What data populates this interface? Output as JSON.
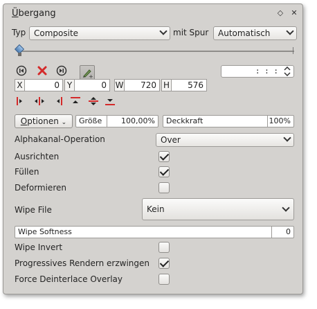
{
  "panel": {
    "title": "Übergang",
    "title_first": "Ü",
    "title_rest": "bergang",
    "float_icon": "◇",
    "close_icon": "✕"
  },
  "row_type": {
    "type_label": "Typ",
    "type_value": "Composite",
    "track_label": "mit Spur",
    "track_value": "Automatisch"
  },
  "timecode": {
    "value": ": : :"
  },
  "geometry": {
    "x_label": "X",
    "x_value": "0",
    "y_label": "Y",
    "y_value": "0",
    "w_label": "W",
    "w_value": "720",
    "h_label": "H",
    "h_value": "576"
  },
  "options": {
    "button_first": "O",
    "button_rest": "ptionen",
    "size_label": "Größe",
    "size_value": "100,00%",
    "opacity_label": "Deckkraft",
    "opacity_value": "100%"
  },
  "params": {
    "alpha_label": "Alphakanal-Operation",
    "alpha_value": "Over",
    "align_label": "Ausrichten",
    "fill_label": "Füllen",
    "distort_label": "Deformieren",
    "wipe_file_label": "Wipe File",
    "wipe_file_value": "Kein",
    "wipe_softness_label": "Wipe Softness",
    "wipe_softness_value": "0",
    "wipe_invert_label": "Wipe Invert",
    "progressive_label": "Progressives Rendern erzwingen",
    "deinterlace_label": "Force Deinterlace Overlay"
  },
  "checks": {
    "align": true,
    "fill": true,
    "distort": false,
    "wipe_invert": false,
    "progressive": true,
    "deinterlace": false
  },
  "colors": {
    "accent_red": "#d42a2a",
    "panel_bg": "#d4d2cf"
  }
}
